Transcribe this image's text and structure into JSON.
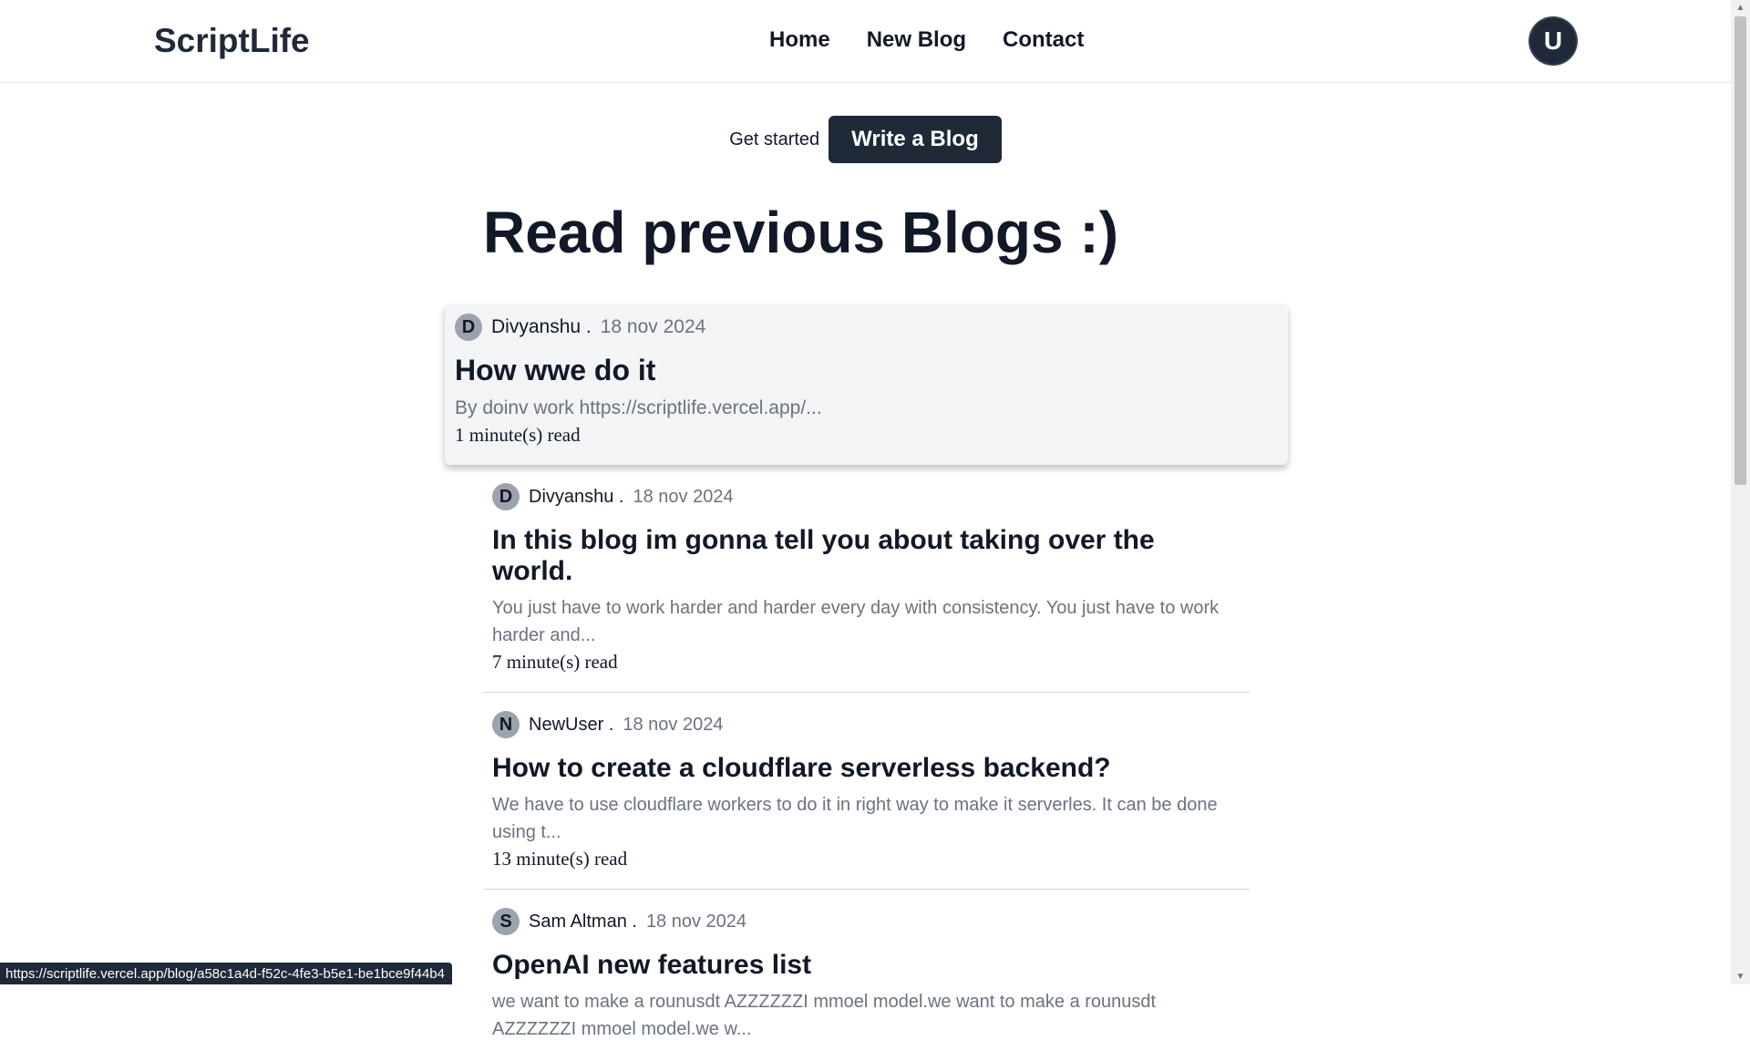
{
  "header": {
    "brand": "ScriptLife",
    "nav": [
      "Home",
      "New Blog",
      "Contact"
    ],
    "avatar_initial": "U"
  },
  "cta": {
    "text": "Get started",
    "button": "Write a Blog"
  },
  "page_title": "Read previous Blogs :)",
  "posts": [
    {
      "initial": "D",
      "author": "Divyanshu .",
      "date": "18 nov 2024",
      "title": "How wwe do it",
      "excerpt": "By doinv work https://scriptlife.vercel.app/...",
      "read_time": "1 minute(s) read"
    },
    {
      "initial": "D",
      "author": "Divyanshu .",
      "date": "18 nov 2024",
      "title": "In this blog im gonna tell you about taking over the world.",
      "excerpt": "You just have to work harder and harder every day with consistency. You just have to work harder and...",
      "read_time": "7 minute(s) read"
    },
    {
      "initial": "N",
      "author": "NewUser .",
      "date": "18 nov 2024",
      "title": "How to create a cloudflare serverless backend?",
      "excerpt": "We have to use cloudflare workers to do it in right way to make it serverles. It can be done using t...",
      "read_time": "13 minute(s) read"
    },
    {
      "initial": "S",
      "author": "Sam Altman .",
      "date": "18 nov 2024",
      "title": "OpenAI new features list",
      "excerpt": "we want to make a rounusdt AZZZZZZI mmoel model.we want to make a rounusdt AZZZZZZI mmoel model.we w..."
    }
  ],
  "status_bar_url": "https://scriptlife.vercel.app/blog/a58c1a4d-f52c-4fe3-b5e1-be1bce9f44b4",
  "colors": {
    "primary_dark": "#1f2937",
    "muted_text": "#6b7280",
    "card_highlight": "#f3f4f6"
  }
}
